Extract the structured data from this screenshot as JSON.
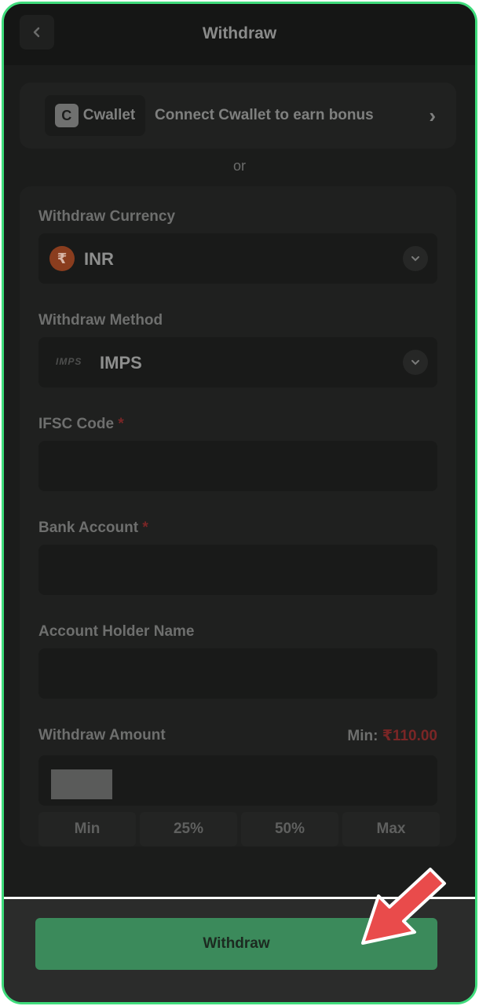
{
  "header": {
    "title": "Withdraw"
  },
  "cwallet": {
    "brand": "Cwallet",
    "text": "Connect Cwallet to earn bonus"
  },
  "or_text": "or",
  "form": {
    "currency": {
      "label": "Withdraw Currency",
      "value": "INR",
      "symbol": "₹"
    },
    "method": {
      "label": "Withdraw Method",
      "value": "IMPS",
      "logo_text": "IMPS"
    },
    "ifsc": {
      "label": "IFSC Code",
      "required_mark": "*"
    },
    "bank": {
      "label": "Bank Account",
      "required_mark": "*"
    },
    "holder": {
      "label": "Account Holder Name"
    },
    "amount": {
      "label": "Withdraw Amount",
      "min_label": "Min:",
      "min_value": "₹110.00"
    },
    "quick": [
      "Min",
      "25%",
      "50%",
      "Max"
    ]
  },
  "footer": {
    "withdraw_label": "Withdraw"
  },
  "colors": {
    "accent": "#3fdc7c",
    "button": "#3b8a5b",
    "arrow": "#e94b4b"
  }
}
